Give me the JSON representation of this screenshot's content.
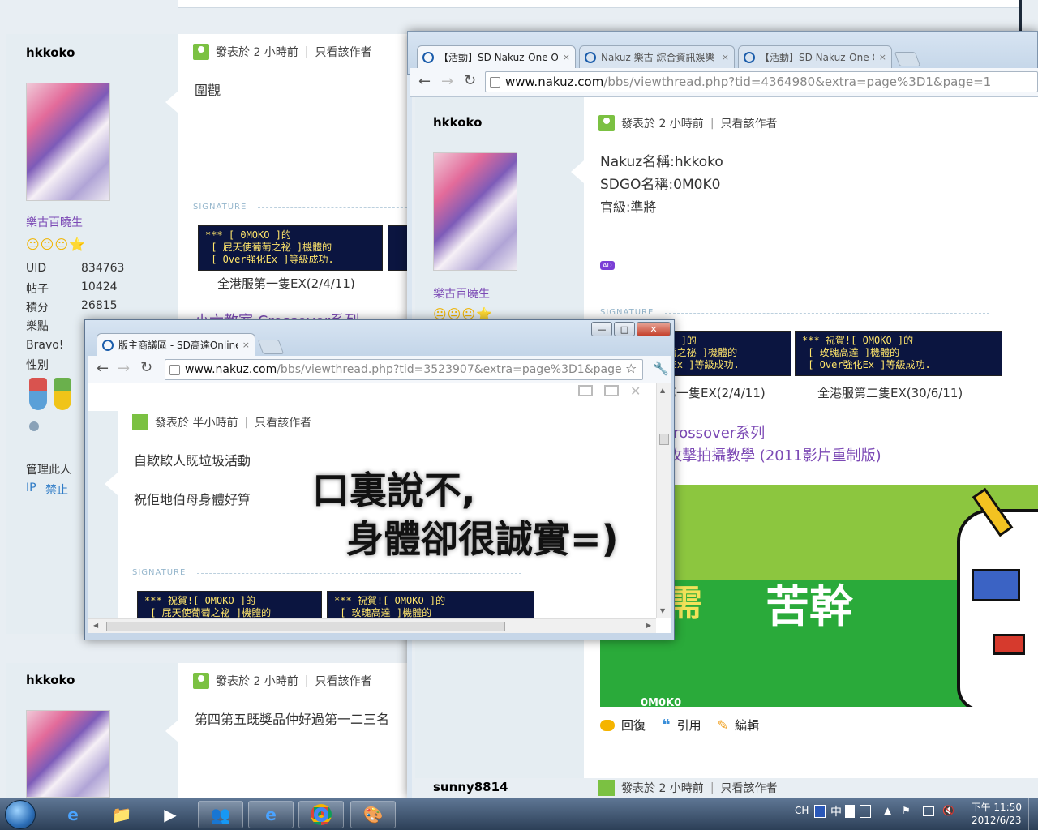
{
  "background_posts": {
    "post1": {
      "username": "hkkoko",
      "rank": "樂古百曉生",
      "stars": "😐😐😐⭐",
      "posted": "發表於 2 小時前",
      "separator": "|",
      "only_author": "只看該作者",
      "content": "圍觀",
      "signature_label": "SIGNATURE",
      "banner1_text": "*** [ 0MOKO ]的\n [ 屁天使葡萄之祕 ]機體的\n [ Over強化Ex ]等級成功.",
      "caption1": "全港服第一隻EX(2/4/11)",
      "stats": [
        {
          "k": "UID",
          "v": "834763"
        },
        {
          "k": "帖子",
          "v": "10424"
        },
        {
          "k": "積分",
          "v": "26815"
        },
        {
          "k": "樂點",
          "v": ""
        },
        {
          "k": "Bravo!",
          "v": ""
        },
        {
          "k": "性別",
          "v": ""
        }
      ],
      "manage": "管理此人",
      "ip": "IP",
      "ban": "禁止",
      "link_partial": "小六教室 Crossover系列"
    },
    "post2": {
      "username": "hkkoko",
      "posted": "發表於 2 小時前",
      "separator": "|",
      "only_author": "只看該作者",
      "content": "第四第五既獎品仲好過第一二三名"
    }
  },
  "window_large": {
    "tabs": [
      {
        "label": "【活動】SD Nakuz-One O",
        "close": "×"
      },
      {
        "label": "Nakuz 樂古 綜合資訊娛樂",
        "close": "×"
      },
      {
        "label": "【活動】SD Nakuz-One O",
        "close": "×"
      }
    ],
    "url_host": "www.nakuz.com",
    "url_path": "/bbs/viewthread.php?tid=4364980&extra=page%3D1&page=1",
    "post": {
      "username": "hkkoko",
      "rank": "樂古百曉生",
      "stars": "😐😐😐⭐",
      "posted": "發表於 2 小時前",
      "separator": "|",
      "only_author": "只看該作者",
      "lines": [
        "Nakuz名稱:hkkoko",
        "SDGO名稱:0M0K0",
        "官級:準將"
      ],
      "ad_badge": "AD",
      "signature_label": "SIGNATURE",
      "banner1_text": "*** [ 0MOKO ]的\n [ 屁天使葡萄之祕 ]機體的\n [ Over強化Ex ]等級成功.",
      "banner2_text": "*** 祝賀![ OMOKO ]的\n [ 玫瑰高達 ]機體的\n [ Over強化Ex ]等級成功.",
      "caption1": "全港服第一隻EX(2/4/11)",
      "caption2": "全港服第二隻EX(30/6/11)",
      "link1": "小六教室 Crossover系列",
      "link2": "\"GP\" 正面攻擊拍攝教學 (2011影片重制版)",
      "image_text1": "成功需",
      "image_text2": "苦幹",
      "image_small": "0M0K0",
      "reply": "回復",
      "quote": "引用",
      "edit": "編輯"
    },
    "next_user": "sunny8814",
    "next_posted": "發表於 2 小時前",
    "next_only_author": "只看該作者"
  },
  "window_small": {
    "tab_label": "版主商議區 - SD高達Online",
    "tab_close": "×",
    "url_host": "www.nakuz.com",
    "url_path": "/bbs/viewthread.php?tid=3523907&extra=page%3D1&page",
    "min": "—",
    "max": "□",
    "close": "✕",
    "post": {
      "posted": "發表於 半小時前",
      "separator": "|",
      "only_author": "只看該作者",
      "line1": "自欺欺人既垃圾活動",
      "line2": "祝佢地伯母身體好算",
      "big1": "口裏說不,",
      "big2": "身體卻很誠實=)",
      "signature_label": "SIGNATURE",
      "banner1_text": "*** 祝賀![ OMOKO ]的\n [ 屁天使葡萄之祕 ]機體的",
      "banner2_text": "*** 祝賀![ OMOKO ]的\n [ 玫瑰高達 ]機體的"
    }
  },
  "taskbar": {
    "lang": "CH",
    "ime": "中",
    "clock_time": "下午 11:50",
    "clock_date": "2012/6/23"
  },
  "colors": {
    "link_purple": "#7c4ab5",
    "green_image": "#8cc63f",
    "green_image_dark": "#2aaa3a"
  }
}
